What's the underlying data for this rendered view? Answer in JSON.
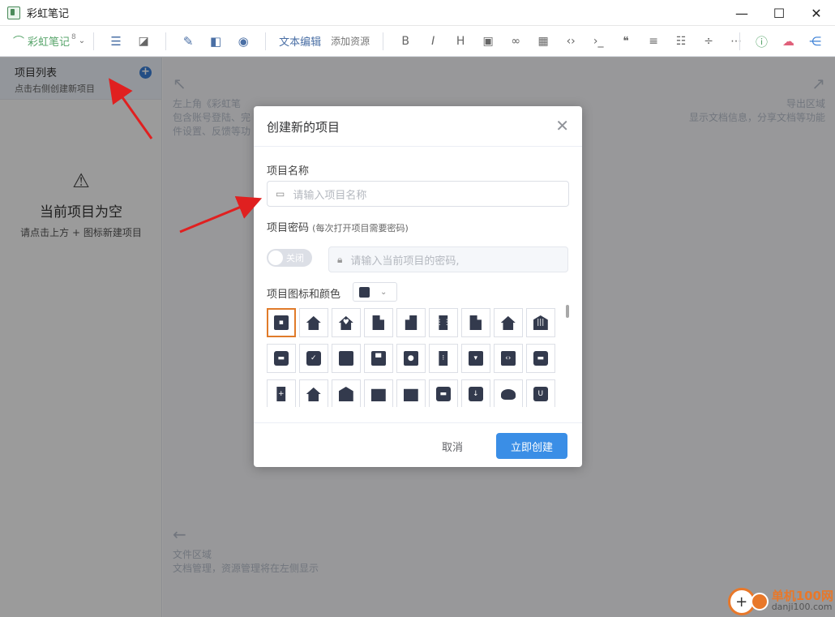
{
  "window": {
    "title": "彩虹笔记",
    "min": "—",
    "max": "☐",
    "close": "✕"
  },
  "toolbar": {
    "brand": "彩虹笔记",
    "brand_sup": "8",
    "text_edit": "文本编辑",
    "add_resource": "添加资源"
  },
  "sidebar": {
    "title": "项目列表",
    "subtitle": "点击右侧创建新项目",
    "empty_title": "当前项目为空",
    "empty_sub": "请点击上方 + 图标新建项目"
  },
  "main": {
    "hint_top_left_1": "左上角《彩虹笔",
    "hint_top_left_2": "包含账号登陆、完",
    "hint_top_left_3": "件设置、反馈等功",
    "hint_top_right_1": "导出区域",
    "hint_top_right_2": "显示文档信息，分享文档等功能",
    "hint_bottom_1": "文件区域",
    "hint_bottom_2": "文档管理，资源管理将在左侧显示"
  },
  "dialog": {
    "title": "创建新的项目",
    "name_label": "项目名称",
    "name_placeholder": "请输入项目名称",
    "pwd_label": "项目密码",
    "pwd_note": "(每次打开项目需要密码)",
    "toggle_text": "关闭",
    "pwd_placeholder": "请输入当前项目的密码,",
    "icon_label": "项目图标和颜色",
    "selected_color": "#333a4d",
    "cancel": "取消",
    "confirm": "立即创建"
  },
  "watermark": {
    "line1": "单机100网",
    "line2": "danji100.com"
  }
}
